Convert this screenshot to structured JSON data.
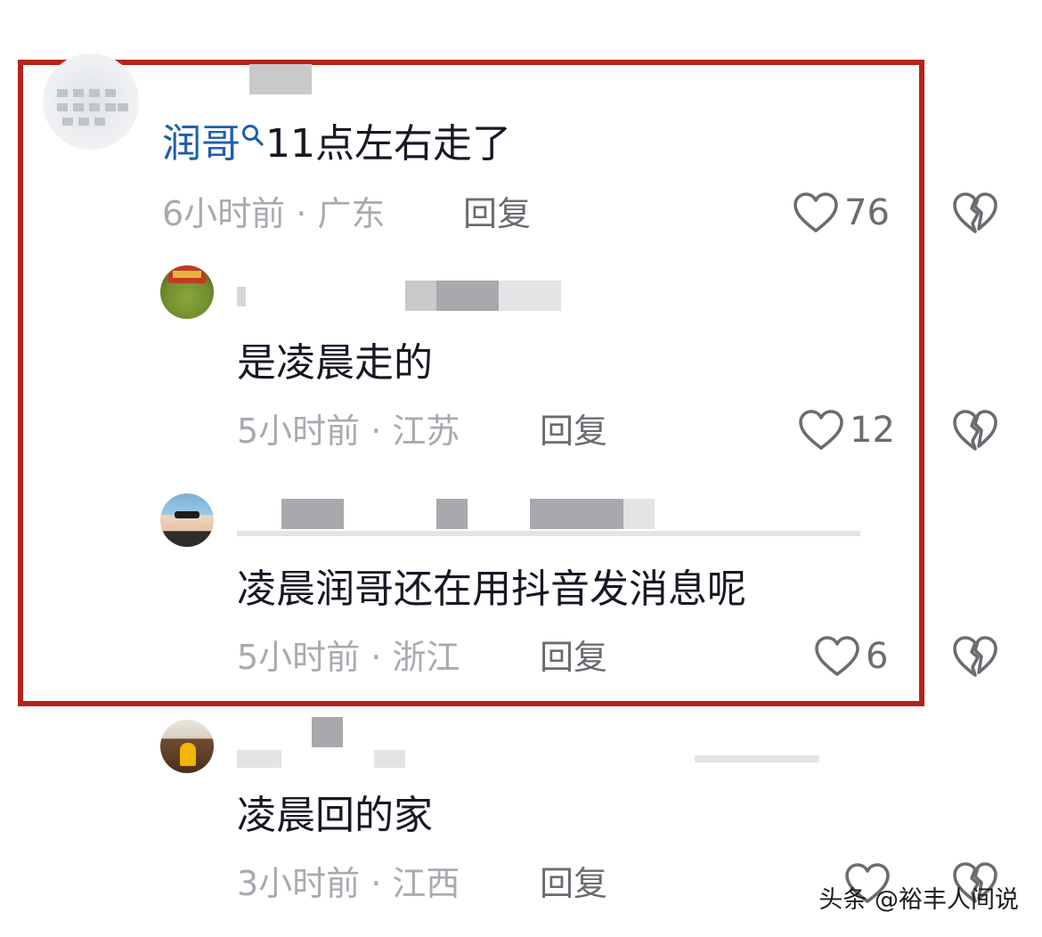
{
  "comments": [
    {
      "mention": "润哥",
      "text": "11点左右走了",
      "time_region": "6小时前 · 广东",
      "reply_label": "回复",
      "likes": "76"
    },
    {
      "text": "是凌晨走的",
      "time_region": "5小时前 · 江苏",
      "reply_label": "回复",
      "likes": "12"
    },
    {
      "text": "凌晨润哥还在用抖音发消息呢",
      "time_region": "5小时前 · 浙江",
      "reply_label": "回复",
      "likes": "6"
    },
    {
      "text": "凌晨回的家",
      "time_region": "3小时前 · 江西",
      "reply_label": "回复"
    }
  ],
  "icons": {
    "like": "heart-outline-icon",
    "dislike": "broken-heart-icon",
    "search": "search-icon"
  },
  "colors": {
    "highlight_border": "#b5231b",
    "mention": "#1f5ea8",
    "meta": "#a9aab0"
  },
  "watermark": "头条 @裕丰人间说"
}
